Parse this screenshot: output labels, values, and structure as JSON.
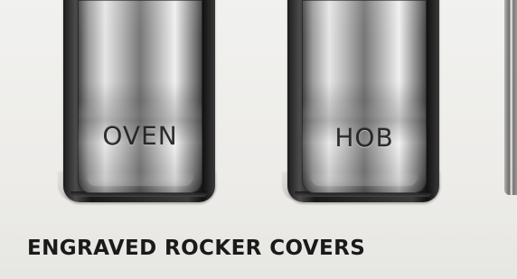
{
  "switches": [
    {
      "label": "OVEN"
    },
    {
      "label": "HOB"
    }
  ],
  "caption": "ENGRAVED ROCKER COVERS",
  "colors": {
    "background": "#efefed",
    "caption_text": "#1a1a1a",
    "engraving": "#1f1f1f"
  }
}
